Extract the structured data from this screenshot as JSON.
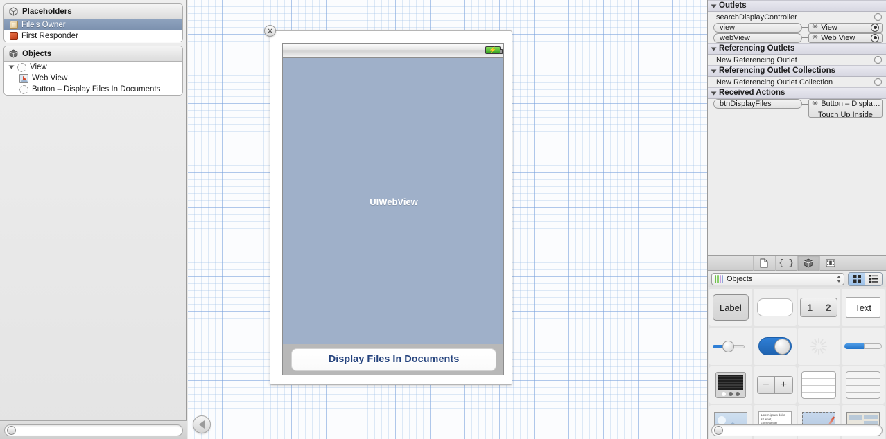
{
  "outline": {
    "placeholders": {
      "title": "Placeholders",
      "icon": "cube-outline-icon",
      "items": [
        {
          "label": "File's Owner",
          "icon": "files-owner-icon",
          "selected": true
        },
        {
          "label": "First Responder",
          "icon": "first-responder-icon",
          "selected": false
        }
      ]
    },
    "objects": {
      "title": "Objects",
      "icon": "cube-solid-icon",
      "items": [
        {
          "label": "View",
          "icon": "dashed-circle-icon",
          "depth": 0,
          "expanded": true
        },
        {
          "label": "Web View",
          "icon": "web-view-icon",
          "depth": 1
        },
        {
          "label": "Button – Display Files In Documents",
          "icon": "dashed-circle-icon",
          "depth": 1
        }
      ]
    },
    "filter": {
      "placeholder": "",
      "value": ""
    }
  },
  "canvas": {
    "close_label": "✕",
    "status_bar": {
      "battery_icon": "battery-charging-icon"
    },
    "web_view_label": "UIWebView",
    "button_label": "Display Files In Documents",
    "back_button_icon": "back-arrow-icon"
  },
  "inspector": {
    "sections": [
      {
        "title": "Outlets",
        "rows": [
          {
            "type": "empty",
            "label": "searchDisplayController"
          },
          {
            "type": "connected",
            "label": "view",
            "target": "View",
            "target_sub": ""
          },
          {
            "type": "connected",
            "label": "webView",
            "target": "Web View",
            "target_sub": ""
          }
        ]
      },
      {
        "title": "Referencing Outlets",
        "rows": [
          {
            "type": "empty",
            "label": "New Referencing Outlet"
          }
        ]
      },
      {
        "title": "Referencing Outlet Collections",
        "rows": [
          {
            "type": "empty",
            "label": "New Referencing Outlet Collection"
          }
        ]
      },
      {
        "title": "Received Actions",
        "rows": [
          {
            "type": "connected",
            "label": "btnDisplayFiles",
            "target": "Button – Displa…",
            "target_sub": "Touch Up Inside"
          }
        ]
      }
    ]
  },
  "library": {
    "tabs": [
      {
        "name": "file-template-library-icon",
        "glyph": "🗎",
        "active": false
      },
      {
        "name": "code-snippet-library-icon",
        "glyph": "{ }",
        "active": false
      },
      {
        "name": "object-library-icon",
        "glyph": "cube",
        "active": true
      },
      {
        "name": "media-library-icon",
        "glyph": "film",
        "active": false
      }
    ],
    "select": {
      "label": "Objects",
      "icon": "color-bars-icon"
    },
    "view_modes": [
      {
        "name": "grid-view-toggle",
        "active": true
      },
      {
        "name": "list-view-toggle",
        "active": false
      }
    ],
    "items": [
      {
        "name": "label-object",
        "kind": "label",
        "text": "Label"
      },
      {
        "name": "round-rect-object",
        "kind": "roundrect",
        "text": ""
      },
      {
        "name": "segmented-control-object",
        "kind": "segment",
        "text": "1 2",
        "seg1": "1",
        "seg2": "2"
      },
      {
        "name": "text-field-object",
        "kind": "textfield",
        "text": "Text"
      },
      {
        "name": "slider-object",
        "kind": "slider",
        "text": ""
      },
      {
        "name": "switch-object",
        "kind": "switch",
        "text": ""
      },
      {
        "name": "activity-indicator-object",
        "kind": "spinner",
        "text": ""
      },
      {
        "name": "progress-view-object",
        "kind": "progress",
        "text": ""
      },
      {
        "name": "picker-view-object",
        "kind": "picker",
        "text": ""
      },
      {
        "name": "stepper-object",
        "kind": "stepper",
        "text": "− +"
      },
      {
        "name": "table-view-plain-object",
        "kind": "tableplain",
        "text": ""
      },
      {
        "name": "table-view-grouped-object",
        "kind": "tablegrouped",
        "text": ""
      },
      {
        "name": "image-view-object",
        "kind": "imageview",
        "text": ""
      },
      {
        "name": "text-view-object",
        "kind": "textview",
        "text": "Lorem ipsum dolor sit amet, consectetuer adipiscing elit."
      },
      {
        "name": "web-view-object",
        "kind": "webview",
        "text": ""
      },
      {
        "name": "map-view-object",
        "kind": "mapview",
        "text": ""
      }
    ],
    "filter": {
      "placeholder": "",
      "value": ""
    }
  },
  "colors": {
    "selection_blue": "#8ea2bd",
    "web_view_fill": "#9fb0c9",
    "button_text": "#26447e",
    "accent_blue": "#2f7fd6",
    "grid_line": "#78a0dc"
  }
}
